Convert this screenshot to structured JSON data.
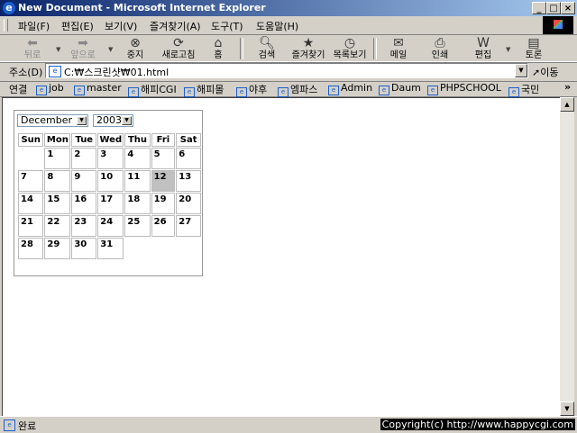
{
  "window": {
    "title": "New Document - Microsoft Internet Explorer",
    "minimize": "_",
    "maximize": "□",
    "close": "×"
  },
  "menu": [
    "파일(F)",
    "편집(E)",
    "보기(V)",
    "즐겨찾기(A)",
    "도구(T)",
    "도움말(H)"
  ],
  "toolbar": {
    "back": "뒤로",
    "forward": "앞으로",
    "stop": "중지",
    "refresh": "새로고침",
    "home": "홈",
    "search": "검색",
    "favorites": "즐겨찾기",
    "history": "목록보기",
    "mail": "메일",
    "print": "인쇄",
    "edit": "편집",
    "discuss": "토론"
  },
  "address": {
    "label": "주소(D)",
    "value": "C:₩스크린샷₩01.html",
    "go": "이동"
  },
  "links": {
    "label": "연결",
    "items": [
      "job",
      "master",
      "해피CGI",
      "해피몰",
      "야후",
      "엠파스",
      "Admin",
      "Daum",
      "PHPSCHOOL",
      "국민"
    ],
    "more": "»"
  },
  "calendar": {
    "month": "December",
    "year": "2003",
    "weekdays": [
      "Sun",
      "Mon",
      "Tue",
      "Wed",
      "Thu",
      "Fri",
      "Sat"
    ],
    "weeks": [
      [
        "",
        "1",
        "2",
        "3",
        "4",
        "5",
        "6"
      ],
      [
        "7",
        "8",
        "9",
        "10",
        "11",
        "12",
        "13"
      ],
      [
        "14",
        "15",
        "16",
        "17",
        "18",
        "19",
        "20"
      ],
      [
        "21",
        "22",
        "23",
        "24",
        "25",
        "26",
        "27"
      ],
      [
        "28",
        "29",
        "30",
        "31",
        "",
        "",
        ""
      ]
    ],
    "highlighted_day": "12",
    "highlight_color": "#c0c0c0"
  },
  "status": {
    "text": "완료",
    "copyright": "Copyright(c) http://www.happycgi.com"
  }
}
